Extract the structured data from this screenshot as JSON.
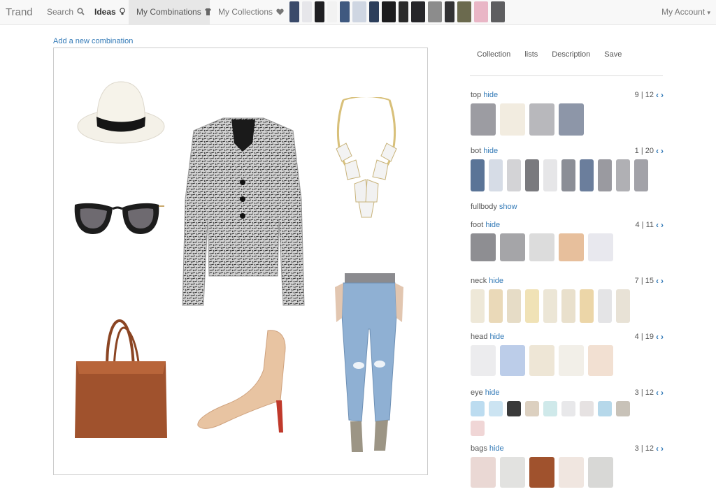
{
  "nav": {
    "brand": "Trand",
    "search": "Search",
    "ideas": "Ideas",
    "my_combinations": "My Combinations",
    "my_collections": "My Collections",
    "account": "My Account",
    "caret": "▾"
  },
  "nav_thumbs": [
    {
      "name": "jeans-dark-thumb",
      "color": "#3a4a6a"
    },
    {
      "name": "pants-light-thumb",
      "color": "#e6e6ea"
    },
    {
      "name": "pants-black-thumb",
      "color": "#1f1f22"
    },
    {
      "name": "pants-white-thumb",
      "color": "#f2f2f2"
    },
    {
      "name": "jeans-blue-thumb",
      "color": "#3f5980"
    },
    {
      "name": "top-light-thumb",
      "color": "#cfd6e2"
    },
    {
      "name": "dress-navy-thumb",
      "color": "#2c3e5b"
    },
    {
      "name": "jacket-black-thumb",
      "color": "#1c1c1e"
    },
    {
      "name": "pants-dark-thumb",
      "color": "#2a2a2a"
    },
    {
      "name": "leather-jacket-thumb",
      "color": "#26262a"
    },
    {
      "name": "coat-gray-thumb",
      "color": "#8c8c8c"
    },
    {
      "name": "coat-black-thumb",
      "color": "#323234"
    },
    {
      "name": "jacket-olive-thumb",
      "color": "#6b6a4e"
    },
    {
      "name": "jacket-pink-thumb",
      "color": "#e9b6c6"
    },
    {
      "name": "jacket-gray-thumb",
      "color": "#5e5e60"
    }
  ],
  "canvas": {
    "add_link": "Add a new combination",
    "colors": {
      "hat": "#f4f1e8",
      "hat_band": "#151515",
      "blazer": "#c9c9c9",
      "necklace": "#ead9a2",
      "bag": "#a0522d",
      "heel": "#e8c4a2",
      "sole": "#c0392b",
      "jeans": "#8fb0d3",
      "boots": "#9c9585"
    }
  },
  "panel": {
    "tabs": [
      "Collection",
      "lists",
      "Description",
      "Save"
    ],
    "categories": [
      {
        "label": "top",
        "toggle": "hide",
        "page": "9 | 12",
        "thumbs": [
          "#9c9ca2",
          "#f2ece0",
          "#b8b8bc",
          "#8d96a8"
        ]
      },
      {
        "label": "bot",
        "toggle": "hide",
        "page": "1 | 20",
        "thumbs": [
          "#5a7497",
          "#d6dce6",
          "#d3d3d6",
          "#7a7a7e",
          "#e6e6e8",
          "#8b8e96",
          "#6b7e9c",
          "#9a9aa0",
          "#b0b0b4",
          "#a2a2a8"
        ]
      },
      {
        "label": "fullbody",
        "toggle": "show",
        "page": "",
        "thumbs": []
      },
      {
        "label": "foot",
        "toggle": "hide",
        "page": "4 | 11",
        "thumbs": [
          "#8e8e92",
          "#a5a5a8",
          "#dcdcdc",
          "#e7bf9c",
          "#e8e8ee"
        ]
      },
      {
        "label": "neck",
        "toggle": "hide",
        "page": "7 | 15",
        "thumbs": [
          "#eee8d8",
          "#ead9b8",
          "#e6dcc6",
          "#f0e2b6",
          "#ece6d6",
          "#e9e0cc",
          "#ecd6a8",
          "#e4e4e6",
          "#e8e2d6"
        ]
      },
      {
        "label": "head",
        "toggle": "hide",
        "page": "4 | 19",
        "thumbs": [
          "#ececee",
          "#bccde9",
          "#eee6d6",
          "#f2efe8",
          "#f2e0d2"
        ]
      },
      {
        "label": "eye",
        "toggle": "hide",
        "page": "3 | 12",
        "thumbs": [
          "#bcdcf0",
          "#cce4f2",
          "#3a3a3a",
          "#dcd0c0",
          "#cfe9ea",
          "#e8e8ea",
          "#e6e2e2",
          "#b6d8ea",
          "#c8c2b8",
          "#f0d6d6"
        ]
      },
      {
        "label": "bags",
        "toggle": "hide",
        "page": "3 | 12",
        "thumbs": [
          "#ead8d4",
          "#e2e2e0",
          "#a0522d",
          "#f0e6e0",
          "#d8d8d6"
        ]
      }
    ]
  }
}
